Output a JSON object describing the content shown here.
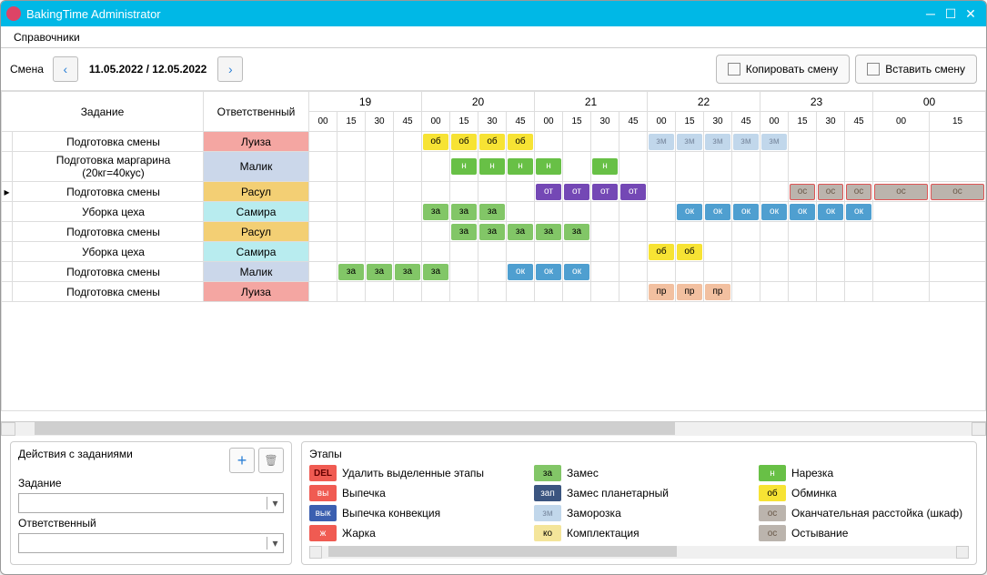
{
  "title": "BakingTime Administrator",
  "menu": {
    "references": "Справочники"
  },
  "toolbar": {
    "shift_label": "Смена",
    "date_range": "11.05.2022 / 12.05.2022",
    "copy_shift": "Копировать смену",
    "paste_shift": "Вставить смену"
  },
  "grid": {
    "task_header": "Задание",
    "responsible_header": "Ответственный",
    "hours": [
      "19",
      "20",
      "21",
      "22",
      "23",
      "00"
    ],
    "quarters": [
      "00",
      "15",
      "30",
      "45",
      "00",
      "15",
      "30",
      "45",
      "00",
      "15",
      "30",
      "45",
      "00",
      "15",
      "30",
      "45",
      "00",
      "15",
      "30",
      "45",
      "00",
      "15"
    ],
    "rows": [
      {
        "task": "Подготовка смены",
        "resp": "Луиза",
        "resp_color": "c-pink",
        "selected": false,
        "cells": [
          "",
          "",
          "",
          "",
          "ob",
          "ob",
          "ob",
          "ob",
          "",
          "",
          "",
          "",
          "zm",
          "zm",
          "zm",
          "zm",
          "zm",
          "",
          "",
          "",
          "",
          ""
        ]
      },
      {
        "task": "Подготовка маргарина (20кг=40кус)",
        "resp": "Малик",
        "resp_color": "c-blue",
        "selected": false,
        "cells": [
          "",
          "",
          "",
          "",
          "",
          "n",
          "n",
          "n",
          "n",
          "",
          "n",
          "",
          "",
          "",
          "",
          "",
          "",
          "",
          "",
          "",
          "",
          ""
        ]
      },
      {
        "task": "Подготовка смены",
        "resp": "Расул",
        "resp_color": "c-yellow",
        "selected": true,
        "cells": [
          "",
          "",
          "",
          "",
          "",
          "",
          "",
          "",
          "ot",
          "ot",
          "ot",
          "ot",
          "",
          "",
          "",
          "",
          "",
          "os",
          "os",
          "os",
          "os",
          "os"
        ]
      },
      {
        "task": "Уборка цеха",
        "resp": "Самира",
        "resp_color": "c-cyan",
        "selected": false,
        "cells": [
          "",
          "",
          "",
          "",
          "za",
          "za",
          "za",
          "",
          "",
          "",
          "",
          "",
          "",
          "ok",
          "ok",
          "ok",
          "ok",
          "ok",
          "ok",
          "ok",
          "",
          ""
        ]
      },
      {
        "task": "Подготовка смены",
        "resp": "Расул",
        "resp_color": "c-yellow",
        "selected": false,
        "cells": [
          "",
          "",
          "",
          "",
          "",
          "za",
          "za",
          "za",
          "za",
          "za",
          "",
          "",
          "",
          "",
          "",
          "",
          "",
          "",
          "",
          "",
          "",
          ""
        ]
      },
      {
        "task": "Уборка цеха",
        "resp": "Самира",
        "resp_color": "c-cyan",
        "selected": false,
        "cells": [
          "",
          "",
          "",
          "",
          "",
          "",
          "",
          "",
          "",
          "",
          "",
          "",
          "ob",
          "ob",
          "",
          "",
          "",
          "",
          "",
          "",
          "",
          ""
        ]
      },
      {
        "task": "Подготовка смены",
        "resp": "Малик",
        "resp_color": "c-blue",
        "selected": false,
        "cells": [
          "",
          "za",
          "za",
          "za",
          "za",
          "",
          "",
          "ok",
          "ok",
          "ok",
          "",
          "",
          "",
          "",
          "",
          "",
          "",
          "",
          "",
          "",
          "",
          ""
        ]
      },
      {
        "task": "Подготовка смены",
        "resp": "Луиза",
        "resp_color": "c-pink",
        "selected": false,
        "cells": [
          "",
          "",
          "",
          "",
          "",
          "",
          "",
          "",
          "",
          "",
          "",
          "",
          "pr",
          "pr",
          "pr",
          "",
          "",
          "",
          "",
          "",
          "",
          ""
        ]
      }
    ],
    "extra_os": [
      "os",
      "os"
    ]
  },
  "actions": {
    "panel_title": "Действия с заданиями",
    "task_label": "Задание",
    "responsible_label": "Ответственный"
  },
  "stages": {
    "panel_title": "Этапы",
    "items": [
      {
        "sw": "sw-del",
        "code": "DEL",
        "label": "Удалить выделенные этапы"
      },
      {
        "sw": "sw-za",
        "code": "за",
        "label": "Замес"
      },
      {
        "sw": "sw-n",
        "code": "н",
        "label": "Нарезка"
      },
      {
        "sw": "sw-vy",
        "code": "вы",
        "label": "Выпечка"
      },
      {
        "sw": "sw-zap",
        "code": "зап",
        "label": "Замес планетарный"
      },
      {
        "sw": "sw-ob",
        "code": "об",
        "label": "Обминка"
      },
      {
        "sw": "sw-vyk",
        "code": "вык",
        "label": "Выпечка конвекция"
      },
      {
        "sw": "sw-zm",
        "code": "зм",
        "label": "Заморозка"
      },
      {
        "sw": "sw-os",
        "code": "ос",
        "label": "Оканчательная расстойка (шкаф)"
      },
      {
        "sw": "sw-zh",
        "code": "ж",
        "label": "Жарка"
      },
      {
        "sw": "sw-ko",
        "code": "ко",
        "label": "Комплектация"
      },
      {
        "sw": "sw-os",
        "code": "ос",
        "label": "Остывание"
      }
    ]
  }
}
